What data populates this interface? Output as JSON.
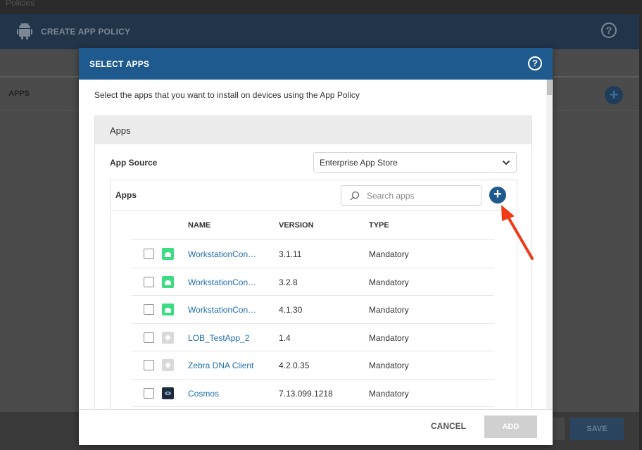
{
  "background": {
    "breadcrumb": "Policies",
    "header_title": "CREATE APP POLICY",
    "section_label": "APPS",
    "save_label": "SAVE"
  },
  "modal": {
    "title": "SELECT APPS",
    "instruction": "Select the apps that you want to install on devices using the App Policy",
    "panel_title": "Apps",
    "app_source": {
      "label": "App Source",
      "value": "Enterprise App Store"
    },
    "apps_box_title": "Apps",
    "search": {
      "placeholder": "Search apps",
      "value": ""
    },
    "table": {
      "columns": [
        "NAME",
        "VERSION",
        "TYPE"
      ],
      "rows": [
        {
          "name": "WorkstationConnect",
          "version": "3.1.11",
          "type": "Mandatory",
          "icon": "android-icon"
        },
        {
          "name": "WorkstationConnect",
          "version": "3.2.8",
          "type": "Mandatory",
          "icon": "android-icon"
        },
        {
          "name": "WorkstationConnect",
          "version": "4.1.30",
          "type": "Mandatory",
          "icon": "android-icon"
        },
        {
          "name": "LOB_TestApp_2",
          "version": "1.4",
          "type": "Mandatory",
          "icon": "generic-app-icon"
        },
        {
          "name": "Zebra DNA Client",
          "version": "4.2.0.35",
          "type": "Mandatory",
          "icon": "generic-app-icon"
        },
        {
          "name": "Cosmos",
          "version": "7.13.099.1218",
          "type": "Mandatory",
          "icon": "cosmos-icon"
        }
      ]
    },
    "footer": {
      "cancel_label": "CANCEL",
      "add_label": "ADD"
    }
  },
  "colors": {
    "modal_header": "#1f5a8f",
    "link": "#1f6fb0",
    "android": "#3ddc84",
    "annotation_arrow": "#f03a17"
  }
}
